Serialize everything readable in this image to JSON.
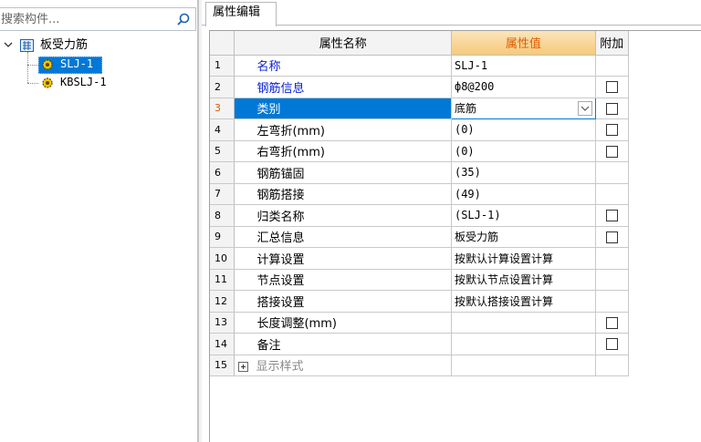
{
  "search": {
    "placeholder": "搜索构件..."
  },
  "tree": {
    "root_label": "板受力筋",
    "items": [
      {
        "label": "SLJ-1",
        "selected": true
      },
      {
        "label": "KBSLJ-1",
        "selected": false
      }
    ]
  },
  "tab": {
    "label": "属性编辑"
  },
  "grid": {
    "headers": {
      "name": "属性名称",
      "value": "属性值",
      "extra": "附加"
    },
    "rows": [
      {
        "num": "1",
        "name": "名称",
        "value": "SLJ-1",
        "checkbox": false
      },
      {
        "num": "2",
        "name": "钢筋信息",
        "value": "ф8@200",
        "checkbox": true
      },
      {
        "num": "3",
        "name": "类别",
        "value": "底筋",
        "checkbox": true
      },
      {
        "num": "4",
        "name": "左弯折(mm)",
        "value": "(0)",
        "checkbox": true
      },
      {
        "num": "5",
        "name": "右弯折(mm)",
        "value": "(0)",
        "checkbox": true
      },
      {
        "num": "6",
        "name": "钢筋锚固",
        "value": "(35)",
        "checkbox": false
      },
      {
        "num": "7",
        "name": "钢筋搭接",
        "value": "(49)",
        "checkbox": false
      },
      {
        "num": "8",
        "name": "归类名称",
        "value": "(SLJ-1)",
        "checkbox": true
      },
      {
        "num": "9",
        "name": "汇总信息",
        "value": "板受力筋",
        "checkbox": true
      },
      {
        "num": "10",
        "name": "计算设置",
        "value": "按默认计算设置计算",
        "checkbox": false
      },
      {
        "num": "11",
        "name": "节点设置",
        "value": "按默认节点设置计算",
        "checkbox": false
      },
      {
        "num": "12",
        "name": "搭接设置",
        "value": "按默认搭接设置计算",
        "checkbox": false
      },
      {
        "num": "13",
        "name": "长度调整(mm)",
        "value": "",
        "checkbox": true
      },
      {
        "num": "14",
        "name": "备注",
        "value": "",
        "checkbox": true
      },
      {
        "num": "15",
        "name": "显示样式",
        "value": "",
        "checkbox": false
      }
    ]
  },
  "colors": {
    "selection": "#0078d7",
    "value_header": "#e05a00",
    "link_blue": "#0a22d8"
  }
}
